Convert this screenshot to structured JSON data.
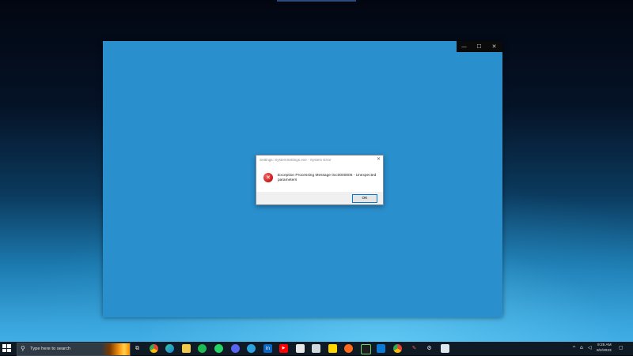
{
  "window": {
    "controls": {
      "minimize": "—",
      "maximize": "☐",
      "close": "✕"
    }
  },
  "dialog": {
    "title": "Settings: SystemSettings.exe - System Error",
    "close_glyph": "✕",
    "icon": "error-icon",
    "message": "Exception Processing Message 0xc0000005 - Unexpected parameters",
    "ok_label": "OK"
  },
  "taskbar": {
    "search_placeholder": "Type here to search",
    "apps": [
      "task-view",
      "chrome",
      "edge",
      "file-explorer",
      "spotify",
      "whatsapp",
      "discord",
      "telegram",
      "linkedin",
      "youtube",
      "store",
      "notepad",
      "sticky-notes",
      "brave",
      "terminal",
      "vscode",
      "chrome-profile",
      "pin",
      "settings",
      "snipping"
    ],
    "tray": {
      "chevron": "^",
      "network": "⌂",
      "time": "9:25 AM",
      "date": "8/2/2023",
      "notifications": "▢"
    }
  },
  "colors": {
    "app_window_bg": "#2a8fcd",
    "taskbar_bg": "#0f1a24",
    "error_red": "#d42020",
    "ok_border": "#0078d7"
  }
}
